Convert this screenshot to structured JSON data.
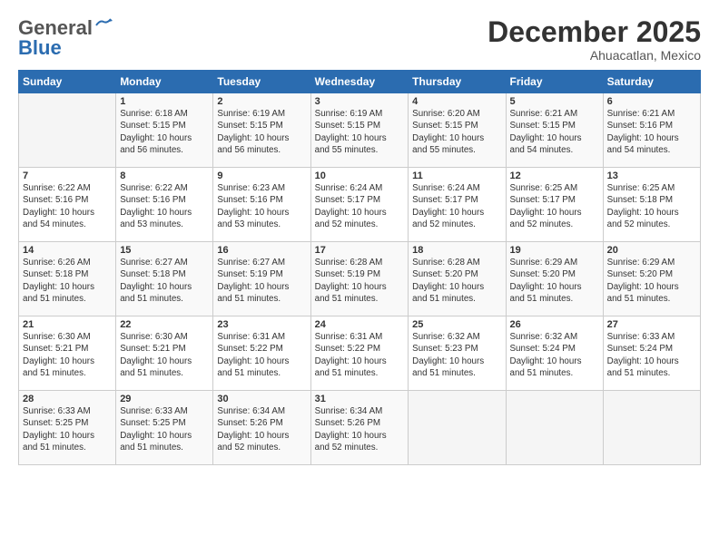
{
  "logo": {
    "general": "General",
    "blue": "Blue"
  },
  "title": {
    "month": "December 2025",
    "location": "Ahuacatlan, Mexico"
  },
  "header_days": [
    "Sunday",
    "Monday",
    "Tuesday",
    "Wednesday",
    "Thursday",
    "Friday",
    "Saturday"
  ],
  "weeks": [
    [
      {
        "day": "",
        "info": ""
      },
      {
        "day": "1",
        "info": "Sunrise: 6:18 AM\nSunset: 5:15 PM\nDaylight: 10 hours\nand 56 minutes."
      },
      {
        "day": "2",
        "info": "Sunrise: 6:19 AM\nSunset: 5:15 PM\nDaylight: 10 hours\nand 56 minutes."
      },
      {
        "day": "3",
        "info": "Sunrise: 6:19 AM\nSunset: 5:15 PM\nDaylight: 10 hours\nand 55 minutes."
      },
      {
        "day": "4",
        "info": "Sunrise: 6:20 AM\nSunset: 5:15 PM\nDaylight: 10 hours\nand 55 minutes."
      },
      {
        "day": "5",
        "info": "Sunrise: 6:21 AM\nSunset: 5:15 PM\nDaylight: 10 hours\nand 54 minutes."
      },
      {
        "day": "6",
        "info": "Sunrise: 6:21 AM\nSunset: 5:16 PM\nDaylight: 10 hours\nand 54 minutes."
      }
    ],
    [
      {
        "day": "7",
        "info": "Sunrise: 6:22 AM\nSunset: 5:16 PM\nDaylight: 10 hours\nand 54 minutes."
      },
      {
        "day": "8",
        "info": "Sunrise: 6:22 AM\nSunset: 5:16 PM\nDaylight: 10 hours\nand 53 minutes."
      },
      {
        "day": "9",
        "info": "Sunrise: 6:23 AM\nSunset: 5:16 PM\nDaylight: 10 hours\nand 53 minutes."
      },
      {
        "day": "10",
        "info": "Sunrise: 6:24 AM\nSunset: 5:17 PM\nDaylight: 10 hours\nand 52 minutes."
      },
      {
        "day": "11",
        "info": "Sunrise: 6:24 AM\nSunset: 5:17 PM\nDaylight: 10 hours\nand 52 minutes."
      },
      {
        "day": "12",
        "info": "Sunrise: 6:25 AM\nSunset: 5:17 PM\nDaylight: 10 hours\nand 52 minutes."
      },
      {
        "day": "13",
        "info": "Sunrise: 6:25 AM\nSunset: 5:18 PM\nDaylight: 10 hours\nand 52 minutes."
      }
    ],
    [
      {
        "day": "14",
        "info": "Sunrise: 6:26 AM\nSunset: 5:18 PM\nDaylight: 10 hours\nand 51 minutes."
      },
      {
        "day": "15",
        "info": "Sunrise: 6:27 AM\nSunset: 5:18 PM\nDaylight: 10 hours\nand 51 minutes."
      },
      {
        "day": "16",
        "info": "Sunrise: 6:27 AM\nSunset: 5:19 PM\nDaylight: 10 hours\nand 51 minutes."
      },
      {
        "day": "17",
        "info": "Sunrise: 6:28 AM\nSunset: 5:19 PM\nDaylight: 10 hours\nand 51 minutes."
      },
      {
        "day": "18",
        "info": "Sunrise: 6:28 AM\nSunset: 5:20 PM\nDaylight: 10 hours\nand 51 minutes."
      },
      {
        "day": "19",
        "info": "Sunrise: 6:29 AM\nSunset: 5:20 PM\nDaylight: 10 hours\nand 51 minutes."
      },
      {
        "day": "20",
        "info": "Sunrise: 6:29 AM\nSunset: 5:20 PM\nDaylight: 10 hours\nand 51 minutes."
      }
    ],
    [
      {
        "day": "21",
        "info": "Sunrise: 6:30 AM\nSunset: 5:21 PM\nDaylight: 10 hours\nand 51 minutes."
      },
      {
        "day": "22",
        "info": "Sunrise: 6:30 AM\nSunset: 5:21 PM\nDaylight: 10 hours\nand 51 minutes."
      },
      {
        "day": "23",
        "info": "Sunrise: 6:31 AM\nSunset: 5:22 PM\nDaylight: 10 hours\nand 51 minutes."
      },
      {
        "day": "24",
        "info": "Sunrise: 6:31 AM\nSunset: 5:22 PM\nDaylight: 10 hours\nand 51 minutes."
      },
      {
        "day": "25",
        "info": "Sunrise: 6:32 AM\nSunset: 5:23 PM\nDaylight: 10 hours\nand 51 minutes."
      },
      {
        "day": "26",
        "info": "Sunrise: 6:32 AM\nSunset: 5:24 PM\nDaylight: 10 hours\nand 51 minutes."
      },
      {
        "day": "27",
        "info": "Sunrise: 6:33 AM\nSunset: 5:24 PM\nDaylight: 10 hours\nand 51 minutes."
      }
    ],
    [
      {
        "day": "28",
        "info": "Sunrise: 6:33 AM\nSunset: 5:25 PM\nDaylight: 10 hours\nand 51 minutes."
      },
      {
        "day": "29",
        "info": "Sunrise: 6:33 AM\nSunset: 5:25 PM\nDaylight: 10 hours\nand 51 minutes."
      },
      {
        "day": "30",
        "info": "Sunrise: 6:34 AM\nSunset: 5:26 PM\nDaylight: 10 hours\nand 52 minutes."
      },
      {
        "day": "31",
        "info": "Sunrise: 6:34 AM\nSunset: 5:26 PM\nDaylight: 10 hours\nand 52 minutes."
      },
      {
        "day": "",
        "info": ""
      },
      {
        "day": "",
        "info": ""
      },
      {
        "day": "",
        "info": ""
      }
    ]
  ]
}
